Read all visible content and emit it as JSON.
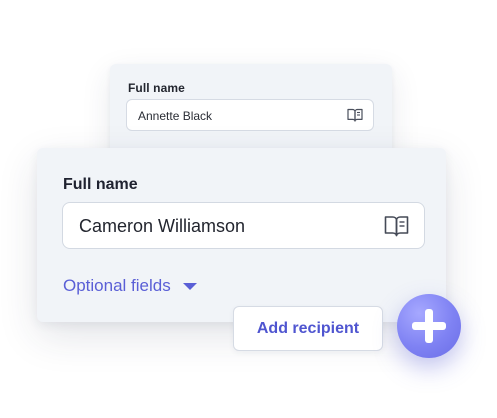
{
  "back_card": {
    "label": "Full name",
    "value": "Annette Black",
    "icon": "address-book-icon"
  },
  "front_card": {
    "label": "Full name",
    "value": "Cameron Williamson",
    "icon": "address-book-icon",
    "optional_fields_label": "Optional fields"
  },
  "actions": {
    "add_recipient_label": "Add recipient",
    "add_icon": "plus-icon"
  },
  "colors": {
    "accent": "#5a5fd6",
    "card_bg": "#f1f4f8",
    "fab": "#7f82f3"
  }
}
